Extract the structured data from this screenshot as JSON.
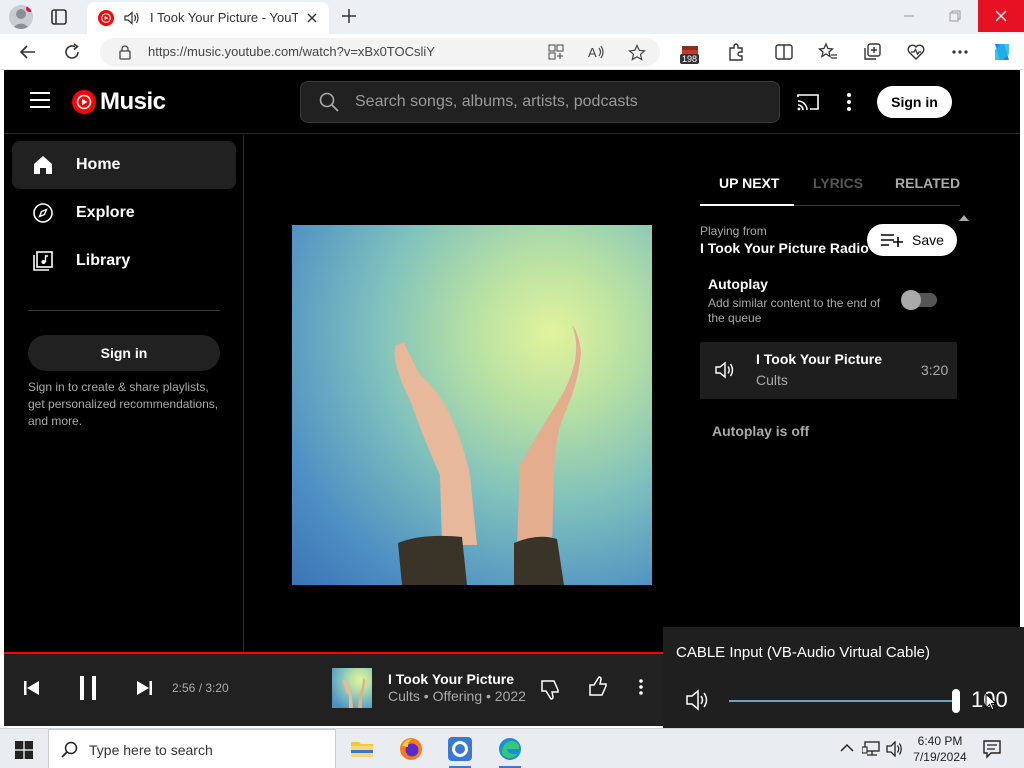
{
  "browser": {
    "tab": {
      "title": "I Took Your Picture - YouTube Music"
    },
    "address": {
      "url": "https://music.youtube.com/watch?v=xBx0TOCsliY"
    },
    "extension_badge": "198"
  },
  "ytmusic": {
    "logo_text": "Music",
    "search_placeholder": "Search songs, albums, artists, podcasts",
    "signin_label": "Sign in",
    "nav": [
      {
        "label": "Home",
        "icon": "home-icon",
        "active": true
      },
      {
        "label": "Explore",
        "icon": "compass-icon"
      },
      {
        "label": "Library",
        "icon": "library-icon"
      }
    ],
    "sidebar_signin_label": "Sign in",
    "sidebar_note": "Sign in to create & share playlists, get personalized recommendations, and more.",
    "right_panel": {
      "tabs": [
        {
          "label": "UP NEXT",
          "active": true
        },
        {
          "label": "LYRICS",
          "disabled": true
        },
        {
          "label": "RELATED"
        }
      ],
      "playing_from_label": "Playing from",
      "playing_from_title": "I Took Your Picture Radio",
      "save_label": "Save",
      "autoplay_title": "Autoplay",
      "autoplay_desc": "Add similar content to the end of the queue",
      "autoplay_on": false,
      "queue": [
        {
          "title": "I Took Your Picture",
          "artist": "Cults",
          "duration": "3:20"
        }
      ],
      "autoplay_off_text": "Autoplay is off"
    },
    "player": {
      "time": "2:56 / 3:20",
      "progress": 0.88,
      "title": "I Took Your Picture",
      "subtitle": "Cults • Offering • 2022"
    }
  },
  "volume_flyout": {
    "device": "CABLE Input (VB-Audio Virtual Cable)",
    "value": "100",
    "level": 1.0
  },
  "taskbar": {
    "search_label": "Type here to search",
    "time": "6:40 PM",
    "date": "7/19/2024"
  },
  "colors": {
    "accent_red": "#ff0000",
    "page_bg": "#000000",
    "panel_bg": "#212121"
  }
}
